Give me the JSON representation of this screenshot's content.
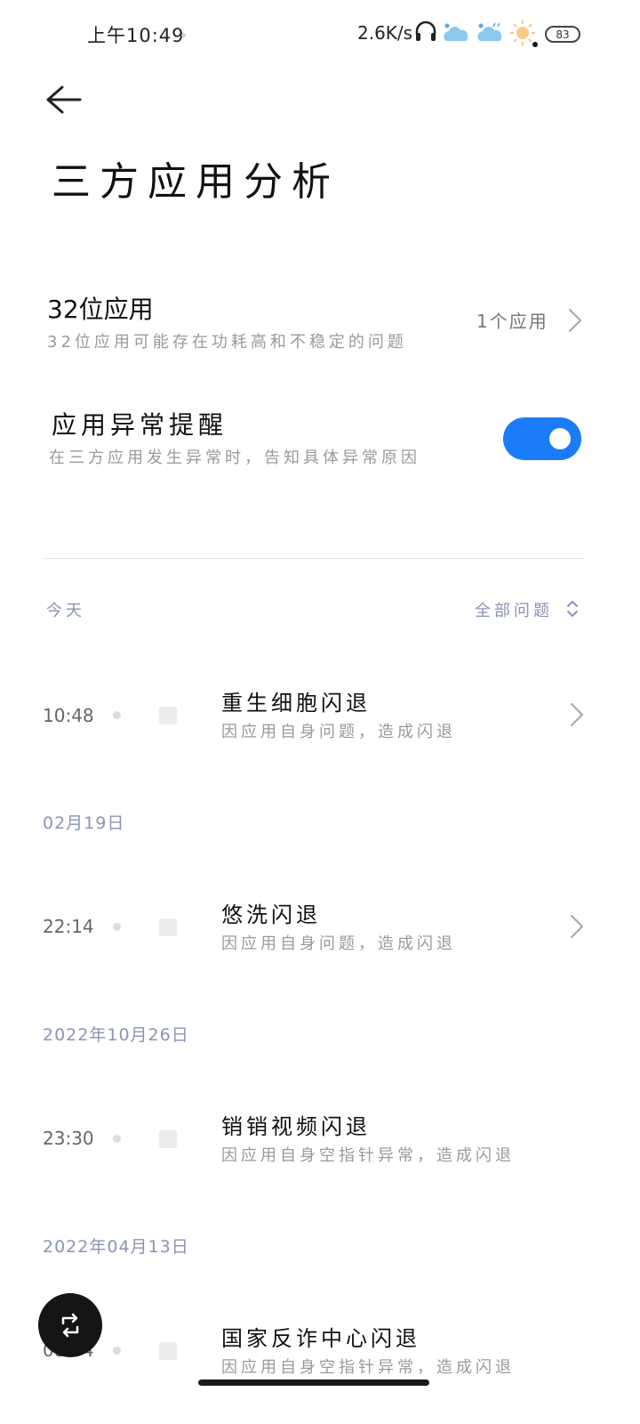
{
  "status_bar": {
    "time": "上午10:49",
    "net_speed": "2.6K/s",
    "battery": "83"
  },
  "header": {
    "title": "三方应用分析"
  },
  "settings": {
    "app32": {
      "title": "32位应用",
      "subtitle": "32位应用可能存在功耗高和不稳定的问题",
      "value": "1个应用"
    },
    "anomaly": {
      "title": "应用异常提醒",
      "subtitle": "在三方应用发生异常时，告知具体异常原因",
      "enabled": true
    }
  },
  "list_header": {
    "section": "今天",
    "filter": "全部问题"
  },
  "groups": [
    {
      "items": [
        {
          "time": "10:48",
          "title": "重生细胞闪退",
          "subtitle": "因应用自身问题，造成闪退"
        }
      ]
    },
    {
      "date": "02月19日",
      "items": [
        {
          "time": "22:14",
          "title": "悠洗闪退",
          "subtitle": "因应用自身问题，造成闪退"
        }
      ]
    },
    {
      "date": "2022年10月26日",
      "items": [
        {
          "time": "23:30",
          "title": "销销视频闪退",
          "subtitle": "因应用自身空指针异常，造成闪退"
        }
      ]
    },
    {
      "date": "2022年04月13日",
      "items": [
        {
          "time": "08:34",
          "title": "国家反诈中心闪退",
          "subtitle": "因应用自身空指针异常，造成闪退"
        }
      ]
    }
  ],
  "colors": {
    "accent": "#1a7cf8",
    "muted_label": "#8a93b8"
  }
}
